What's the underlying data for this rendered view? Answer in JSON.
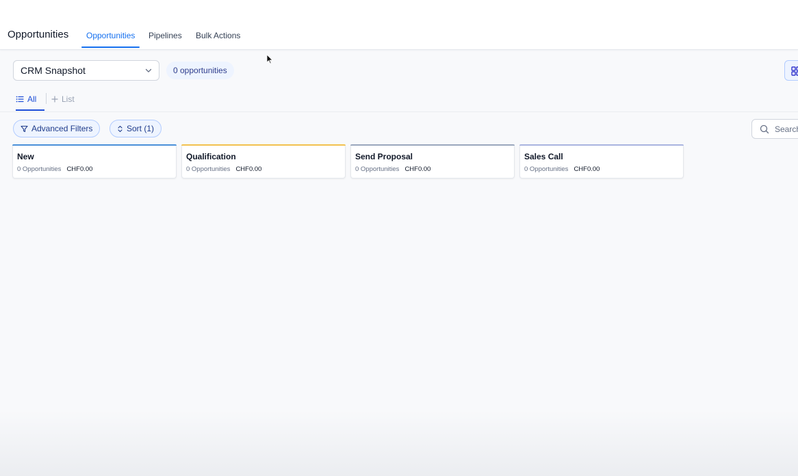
{
  "header": {
    "title": "Opportunities",
    "tabs": [
      {
        "label": "Opportunities",
        "active": true
      },
      {
        "label": "Pipelines",
        "active": false
      },
      {
        "label": "Bulk Actions",
        "active": false
      }
    ]
  },
  "toolbar": {
    "pipeline_select": "CRM Snapshot",
    "count_badge": "0 opportunities"
  },
  "subtabs": {
    "all": "All",
    "list": "List"
  },
  "filters": {
    "advanced": "Advanced Filters",
    "sort": "Sort (1)",
    "search_placeholder": "Search"
  },
  "stages": [
    {
      "name": "New",
      "count": "0 Opportunities",
      "amount": "CHF0.00",
      "color": "#4a90d9"
    },
    {
      "name": "Qualification",
      "count": "0 Opportunities",
      "amount": "CHF0.00",
      "color": "#f2c14e"
    },
    {
      "name": "Send Proposal",
      "count": "0 Opportunities",
      "amount": "CHF0.00",
      "color": "#9aa7bd"
    },
    {
      "name": "Sales Call",
      "count": "0 Opportunities",
      "amount": "CHF0.00",
      "color": "#a9b4e0"
    }
  ],
  "colors": {
    "accent": "#1570ef",
    "pill_bg": "#eef4ff"
  }
}
